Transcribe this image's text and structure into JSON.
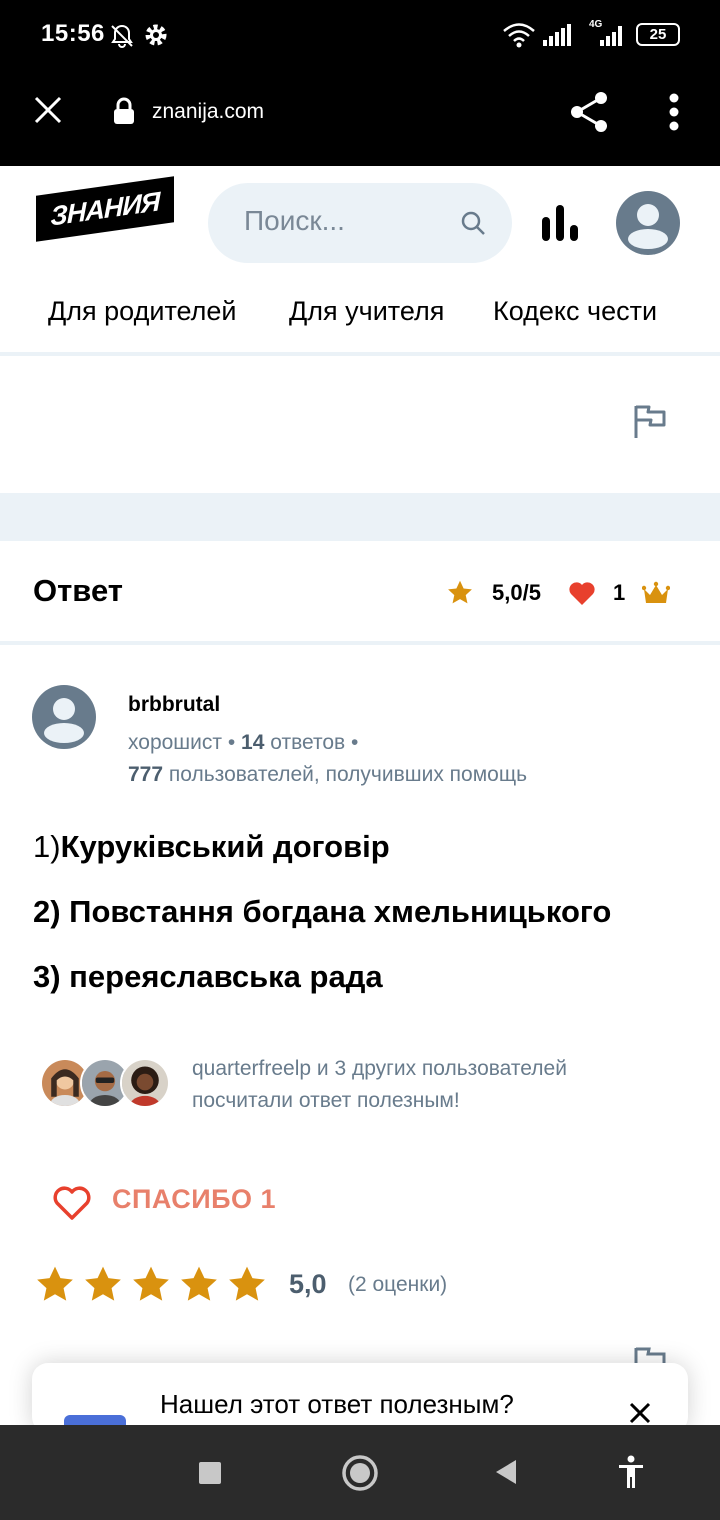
{
  "status_bar": {
    "time": "15:56",
    "battery": "25",
    "network": "4G"
  },
  "browser": {
    "url": "znanija.com"
  },
  "header": {
    "logo": "ЗНАНИЯ",
    "search_placeholder": "Поиск...",
    "nav": [
      "Для родителей",
      "Для учителя",
      "Кодекс чести"
    ]
  },
  "answer": {
    "title": "Ответ",
    "rating": "5,0/5",
    "likes": "1",
    "author": {
      "name": "brbbrutal",
      "rank": "хорошист",
      "answers_count": "14",
      "answers_label": "ответов",
      "helped_count": "777",
      "helped_label": "пользователей, получивших помощь"
    },
    "lines": [
      {
        "prefix": "1)",
        "text": "Куруківський договір"
      },
      {
        "prefix": "",
        "text": "2) Повстання богдана хмельницького"
      },
      {
        "prefix": "",
        "text": "3) переяславська рада"
      }
    ],
    "helpful_text": "quarterfreelp и 3 других пользователей посчитали ответ полезным!",
    "thanks_label": "СПАСИБО 1",
    "stars_value": "5,0",
    "stars_count": "(2 оценки)"
  },
  "popup": {
    "question": "Нашел этот ответ полезным?"
  },
  "colors": {
    "accent": "#e8806b",
    "star": "#d9920f",
    "heart": "#e8402d",
    "band": "#ebf2f7",
    "muted": "#687b8c"
  }
}
